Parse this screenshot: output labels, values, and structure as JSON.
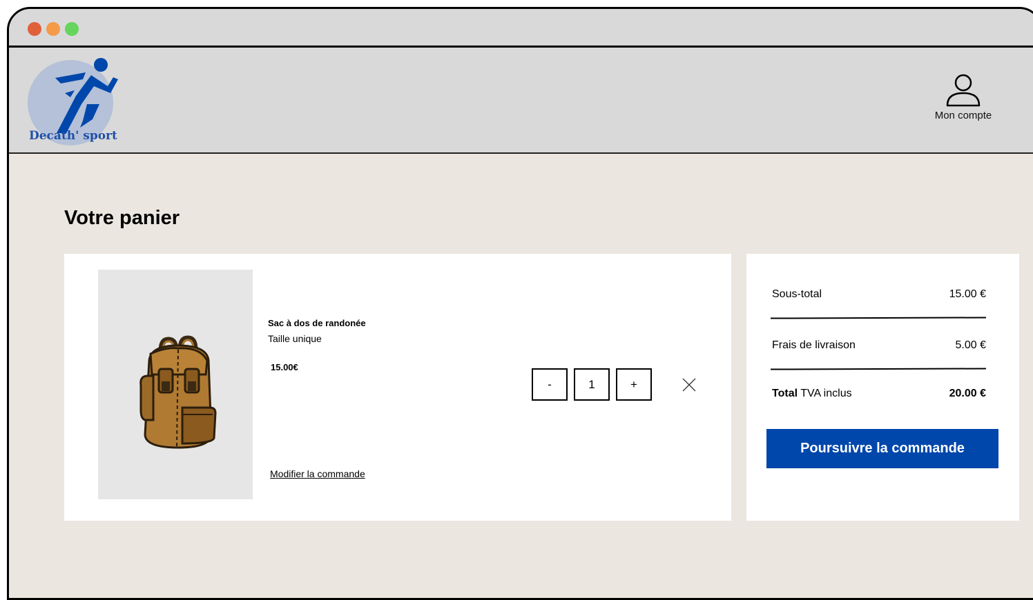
{
  "brand": {
    "name": "Decath' sport",
    "logo_icon": "runner-icon",
    "brand_color": "#1f4fa8"
  },
  "header": {
    "account_label": "Mon compte",
    "account_icon": "user-icon"
  },
  "page": {
    "title": "Votre panier"
  },
  "cart": {
    "items": [
      {
        "name": "Sac à dos de randonée",
        "size": "Taille unique",
        "price": "15.00€",
        "image_icon": "backpack-icon",
        "quantity": "1",
        "minus_label": "-",
        "plus_label": "+",
        "remove_icon": "close-icon",
        "modify_label": "Modifier la commande"
      }
    ]
  },
  "summary": {
    "subtotal_label": "Sous-total",
    "subtotal_value": "15.00 €",
    "shipping_label": "Frais de livraison",
    "shipping_value": "5.00 €",
    "total_label": "Total",
    "total_suffix": " TVA inclus",
    "total_value": "20.00 €",
    "checkout_label": "Poursuivre la commande",
    "accent_color": "#0047ab"
  }
}
